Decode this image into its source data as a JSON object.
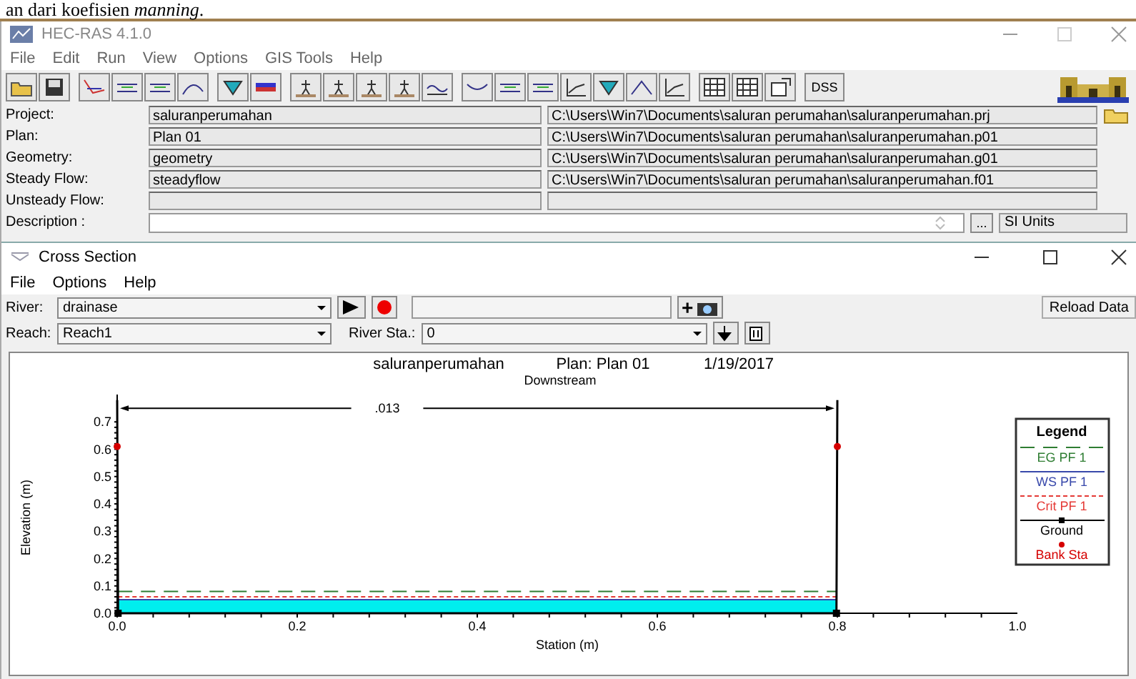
{
  "document_text": "an dari koefisien *manning*.",
  "window": {
    "title": "HEC-RAS 4.1.0",
    "menu": [
      "File",
      "Edit",
      "Run",
      "View",
      "Options",
      "GIS Tools",
      "Help"
    ]
  },
  "toolbar": {
    "dss_label": "DSS"
  },
  "project_rows": [
    {
      "label": "Project:",
      "name": "saluranperumahan",
      "path": "C:\\Users\\Win7\\Documents\\saluran perumahan\\saluranperumahan.prj"
    },
    {
      "label": "Plan:",
      "name": "Plan 01",
      "path": "C:\\Users\\Win7\\Documents\\saluran perumahan\\saluranperumahan.p01"
    },
    {
      "label": "Geometry:",
      "name": "geometry",
      "path": "C:\\Users\\Win7\\Documents\\saluran perumahan\\saluranperumahan.g01"
    },
    {
      "label": "Steady Flow:",
      "name": "steadyflow",
      "path": "C:\\Users\\Win7\\Documents\\saluran perumahan\\saluranperumahan.f01"
    },
    {
      "label": "Unsteady Flow:"
    }
  ],
  "description": {
    "label": "Description :",
    "browse": "...",
    "units": "SI Units"
  },
  "cross_section": {
    "title": "Cross Section",
    "menu": [
      "File",
      "Options",
      "Help"
    ],
    "river": {
      "label": "River:",
      "value": "drainase"
    },
    "reach": {
      "label": "Reach:",
      "value": "Reach1"
    },
    "river_sta": {
      "label": "River Sta.:",
      "value": "0"
    },
    "plus": "+",
    "reload": "Reload Data",
    "plot": {
      "header": [
        "saluranperumahan",
        "Plan: Plan 01",
        "1/19/2017"
      ],
      "subtitle": "Downstream",
      "legend": {
        "title": "Legend"
      },
      "chart_data": {
        "type": "line",
        "xlabel": "Station (m)",
        "ylabel": "Elevation (m)",
        "x": [
          0,
          0.001,
          0.799,
          0.8
        ],
        "series": [
          {
            "name": "EG PF 1",
            "color": "#2e7d32",
            "type": "line",
            "line_style": "dashed",
            "values": [
              null,
              0.08,
              0.08,
              null
            ]
          },
          {
            "name": "WS PF 1",
            "color": "#3949ab",
            "type": "line",
            "line_style": "solid",
            "values": [
              null,
              0.05,
              0.05,
              null
            ]
          },
          {
            "name": "Crit PF 1",
            "color": "#e53935",
            "type": "line",
            "line_style": "dotted",
            "values": [
              null,
              0.06,
              0.06,
              null
            ]
          },
          {
            "name": "Ground",
            "color": "#000000",
            "type": "line",
            "line_style": "solid",
            "marker": "square",
            "values": [
              0.78,
              0,
              0,
              0.78
            ]
          },
          {
            "name": "Bank Sta",
            "color": "#d50000",
            "type": "scatter",
            "values": [
              0.61,
              null,
              null,
              0.61
            ]
          }
        ],
        "legend": "right",
        "xlim": [
          0,
          1
        ],
        "ylim": [
          0,
          0.8
        ],
        "xticks": [
          {
            "value": 0,
            "label": "0.0"
          },
          {
            "value": 0.2,
            "label": "0.2"
          },
          {
            "value": 0.4,
            "label": "0.4"
          },
          {
            "value": 0.6,
            "label": "0.6"
          },
          {
            "value": 0.8,
            "label": "0.8"
          },
          {
            "value": 1,
            "label": "1.0"
          }
        ],
        "yticks": [
          {
            "value": 0,
            "label": "0.0"
          },
          {
            "value": 0.1,
            "label": "0.1"
          },
          {
            "value": 0.2,
            "label": "0.2"
          },
          {
            "value": 0.3,
            "label": "0.3"
          },
          {
            "value": 0.4,
            "label": "0.4"
          },
          {
            "value": 0.5,
            "label": "0.5"
          },
          {
            "value": 0.6,
            "label": "0.6"
          },
          {
            "value": 0.7,
            "label": "0.7"
          }
        ],
        "annotations": [
          ".013"
        ]
      }
    }
  }
}
